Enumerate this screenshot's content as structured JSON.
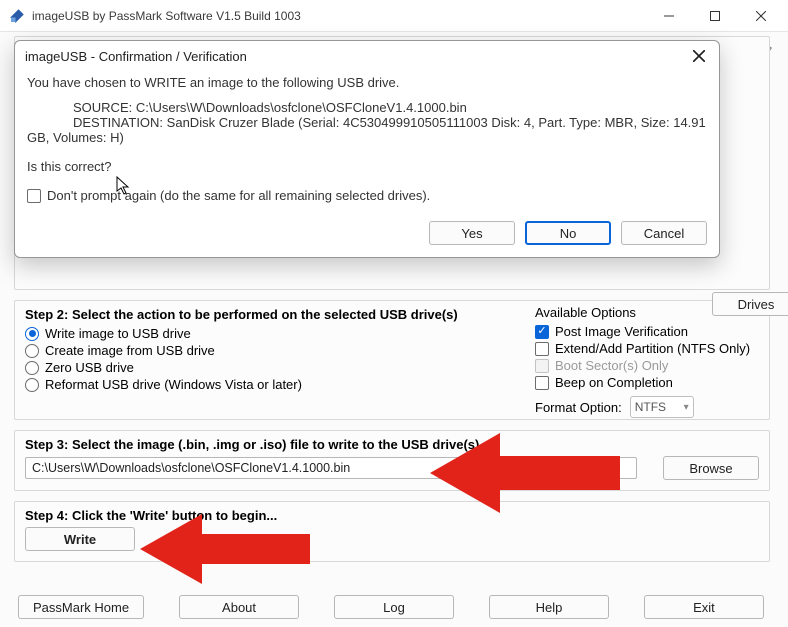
{
  "window": {
    "title": "imageUSB by PassMark Software V1.5 Build 1003"
  },
  "dialog": {
    "title": "imageUSB - Confirmation / Verification",
    "line1": "You have chosen to WRITE an image to the following USB drive.",
    "source_label": "SOURCE:",
    "source_value": "C:\\Users\\W\\Downloads\\osfclone\\OSFCloneV1.4.1000.bin",
    "dest_label": "DESTINATION:",
    "dest_value": "SanDisk Cruzer Blade (Serial: 4C530499910505111003 Disk: 4, Part. Type: MBR, Size: 14.91 GB, Volumes: H)",
    "question": "Is this correct?",
    "dont_prompt": "Don't prompt again (do the same for all remaining selected drives).",
    "yes": "Yes",
    "no": "No",
    "cancel": "Cancel"
  },
  "drives_button": "Drives",
  "step2": {
    "heading": "Step 2: Select the action to be performed on the selected USB drive(s)",
    "options": [
      "Write image to USB drive",
      "Create image from USB drive",
      "Zero USB drive",
      "Reformat USB drive (Windows Vista or later)"
    ],
    "avail_heading": "Available Options",
    "avail": [
      "Post Image Verification",
      "Extend/Add Partition (NTFS Only)",
      "Boot Sector(s) Only",
      "Beep on Completion"
    ],
    "format_label": "Format Option:",
    "format_value": "NTFS"
  },
  "step3": {
    "heading": "Step 3: Select the image (.bin, .img or .iso) file to write to the USB drive(s)",
    "path": "C:\\Users\\W\\Downloads\\osfclone\\OSFCloneV1.4.1000.bin",
    "browse": "Browse"
  },
  "step4": {
    "heading": "Step 4: Click the 'Write' button to begin...",
    "button": "Write"
  },
  "bottom": {
    "home": "PassMark Home",
    "about": "About",
    "log": "Log",
    "help": "Help",
    "exit": "Exit"
  }
}
